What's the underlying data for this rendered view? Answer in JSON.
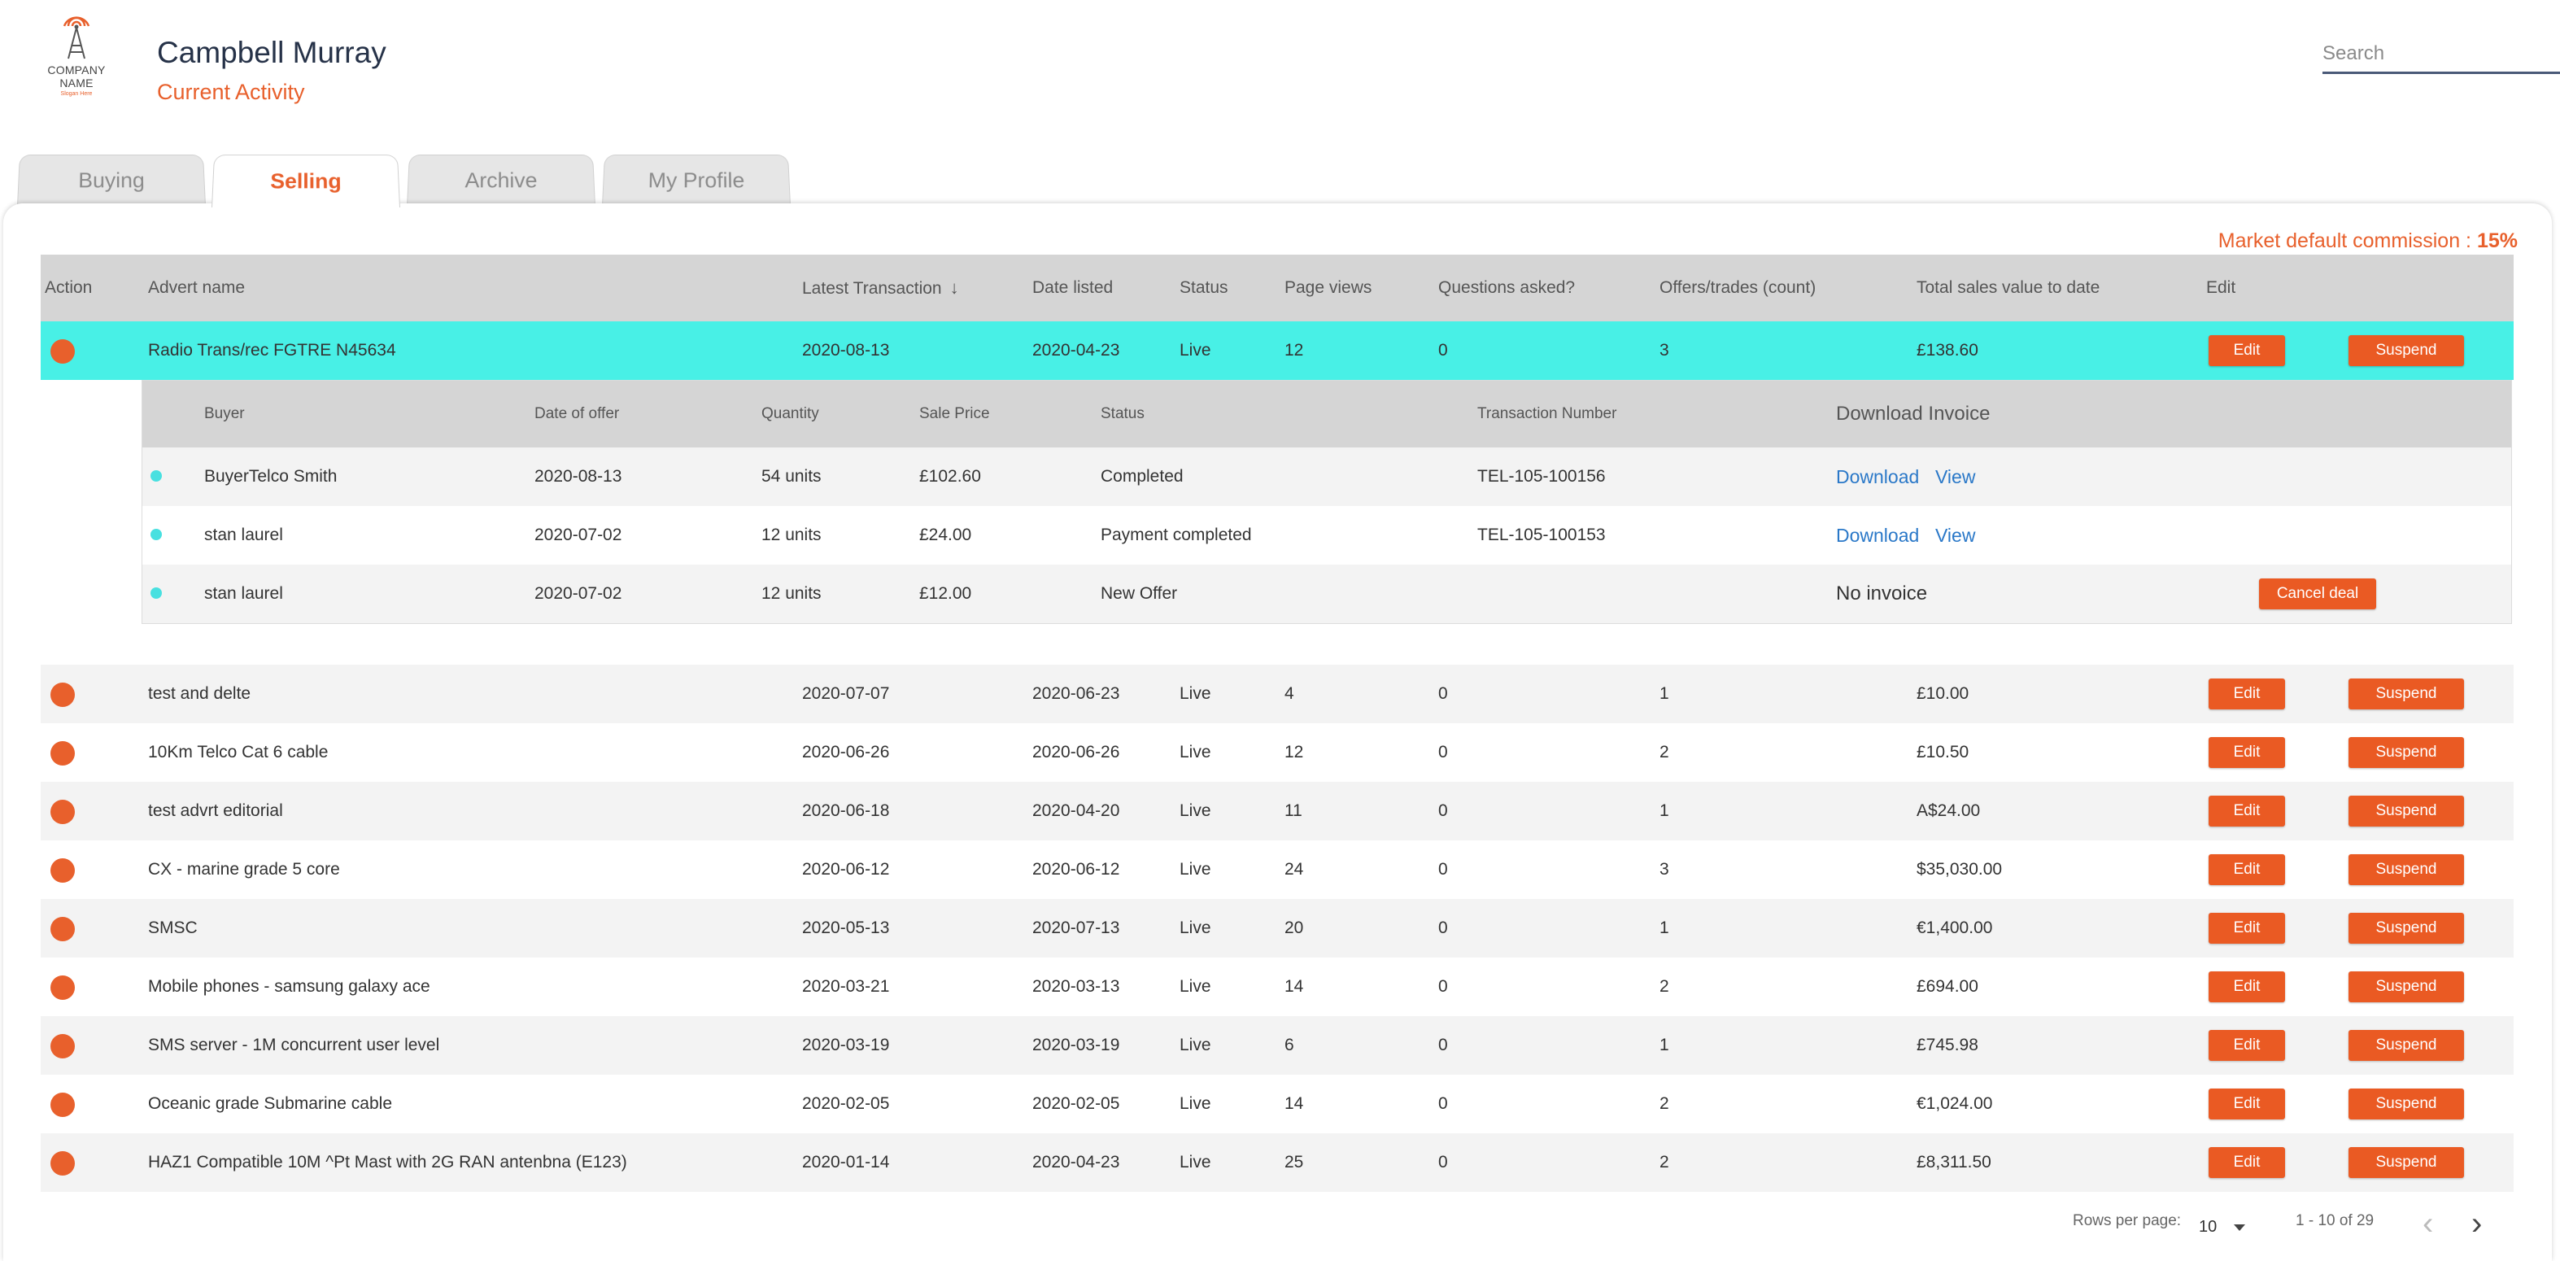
{
  "header": {
    "logo_text": "COMPANY NAME",
    "logo_tagline": "Slogan Here",
    "user_name": "Campbell Murray",
    "page_subtitle": "Current Activity",
    "search_placeholder": "Search"
  },
  "tabs": [
    {
      "label": "Buying",
      "active": false
    },
    {
      "label": "Selling",
      "active": true
    },
    {
      "label": "Archive",
      "active": false
    },
    {
      "label": "My Profile",
      "active": false
    }
  ],
  "commission": {
    "label": "Market default commission :",
    "value": "15%"
  },
  "table": {
    "headers": {
      "action": "Action",
      "advert_name": "Advert name",
      "latest_transaction": "Latest Transaction",
      "date_listed": "Date listed",
      "status": "Status",
      "page_views": "Page views",
      "questions": "Questions asked?",
      "offers": "Offers/trades (count)",
      "total_sales": "Total sales value to date",
      "edit": "Edit"
    },
    "edit_label": "Edit",
    "suspend_label": "Suspend",
    "rows": [
      {
        "name": "Radio Trans/rec FGTRE N45634",
        "latest": "2020-08-13",
        "listed": "2020-04-23",
        "status": "Live",
        "views": "12",
        "questions": "0",
        "offers": "3",
        "total": "£138.60"
      },
      {
        "name": "test and delte",
        "latest": "2020-07-07",
        "listed": "2020-06-23",
        "status": "Live",
        "views": "4",
        "questions": "0",
        "offers": "1",
        "total": "£10.00"
      },
      {
        "name": "10Km Telco Cat 6 cable",
        "latest": "2020-06-26",
        "listed": "2020-06-26",
        "status": "Live",
        "views": "12",
        "questions": "0",
        "offers": "2",
        "total": "£10.50"
      },
      {
        "name": "test advrt editorial",
        "latest": "2020-06-18",
        "listed": "2020-04-20",
        "status": "Live",
        "views": "11",
        "questions": "0",
        "offers": "1",
        "total": "A$24.00"
      },
      {
        "name": "CX - marine grade 5 core",
        "latest": "2020-06-12",
        "listed": "2020-06-12",
        "status": "Live",
        "views": "24",
        "questions": "0",
        "offers": "3",
        "total": "$35,030.00"
      },
      {
        "name": "SMSC",
        "latest": "2020-05-13",
        "listed": "2020-07-13",
        "status": "Live",
        "views": "20",
        "questions": "0",
        "offers": "1",
        "total": "€1,400.00"
      },
      {
        "name": "Mobile phones - samsung galaxy ace",
        "latest": "2020-03-21",
        "listed": "2020-03-13",
        "status": "Live",
        "views": "14",
        "questions": "0",
        "offers": "2",
        "total": "£694.00"
      },
      {
        "name": "SMS server - 1M concurrent user level",
        "latest": "2020-03-19",
        "listed": "2020-03-19",
        "status": "Live",
        "views": "6",
        "questions": "0",
        "offers": "1",
        "total": "£745.98"
      },
      {
        "name": "Oceanic grade Submarine cable",
        "latest": "2020-02-05",
        "listed": "2020-02-05",
        "status": "Live",
        "views": "14",
        "questions": "0",
        "offers": "2",
        "total": "€1,024.00"
      },
      {
        "name": "HAZ1 Compatible 10M ^Pt Mast with 2G RAN antenbna (E123)",
        "latest": "2020-01-14",
        "listed": "2020-04-23",
        "status": "Live",
        "views": "25",
        "questions": "0",
        "offers": "2",
        "total": "£8,311.50"
      }
    ]
  },
  "offers": {
    "headers": {
      "buyer": "Buyer",
      "date": "Date of offer",
      "quantity": "Quantity",
      "price": "Sale Price",
      "status": "Status",
      "transaction": "Transaction Number",
      "invoice": "Download Invoice"
    },
    "download_label": "Download",
    "view_label": "View",
    "no_invoice_label": "No invoice",
    "cancel_label": "Cancel deal",
    "rows": [
      {
        "buyer": "BuyerTelco Smith",
        "date": "2020-08-13",
        "quantity": "54 units",
        "price": "£102.60",
        "status": "Completed",
        "transaction": "TEL-105-100156"
      },
      {
        "buyer": "stan laurel",
        "date": "2020-07-02",
        "quantity": "12 units",
        "price": "£24.00",
        "status": "Payment completed",
        "transaction": "TEL-105-100153"
      },
      {
        "buyer": "stan laurel",
        "date": "2020-07-02",
        "quantity": "12 units",
        "price": "£12.00",
        "status": "New Offer",
        "transaction": ""
      }
    ]
  },
  "pagination": {
    "rows_per_page_label": "Rows per page:",
    "rows_per_page_value": "10",
    "range": "1 - 10 of 29"
  },
  "colors": {
    "accent": "#e8602c",
    "selected_row": "#48f0e6",
    "link": "#2a78c8"
  }
}
